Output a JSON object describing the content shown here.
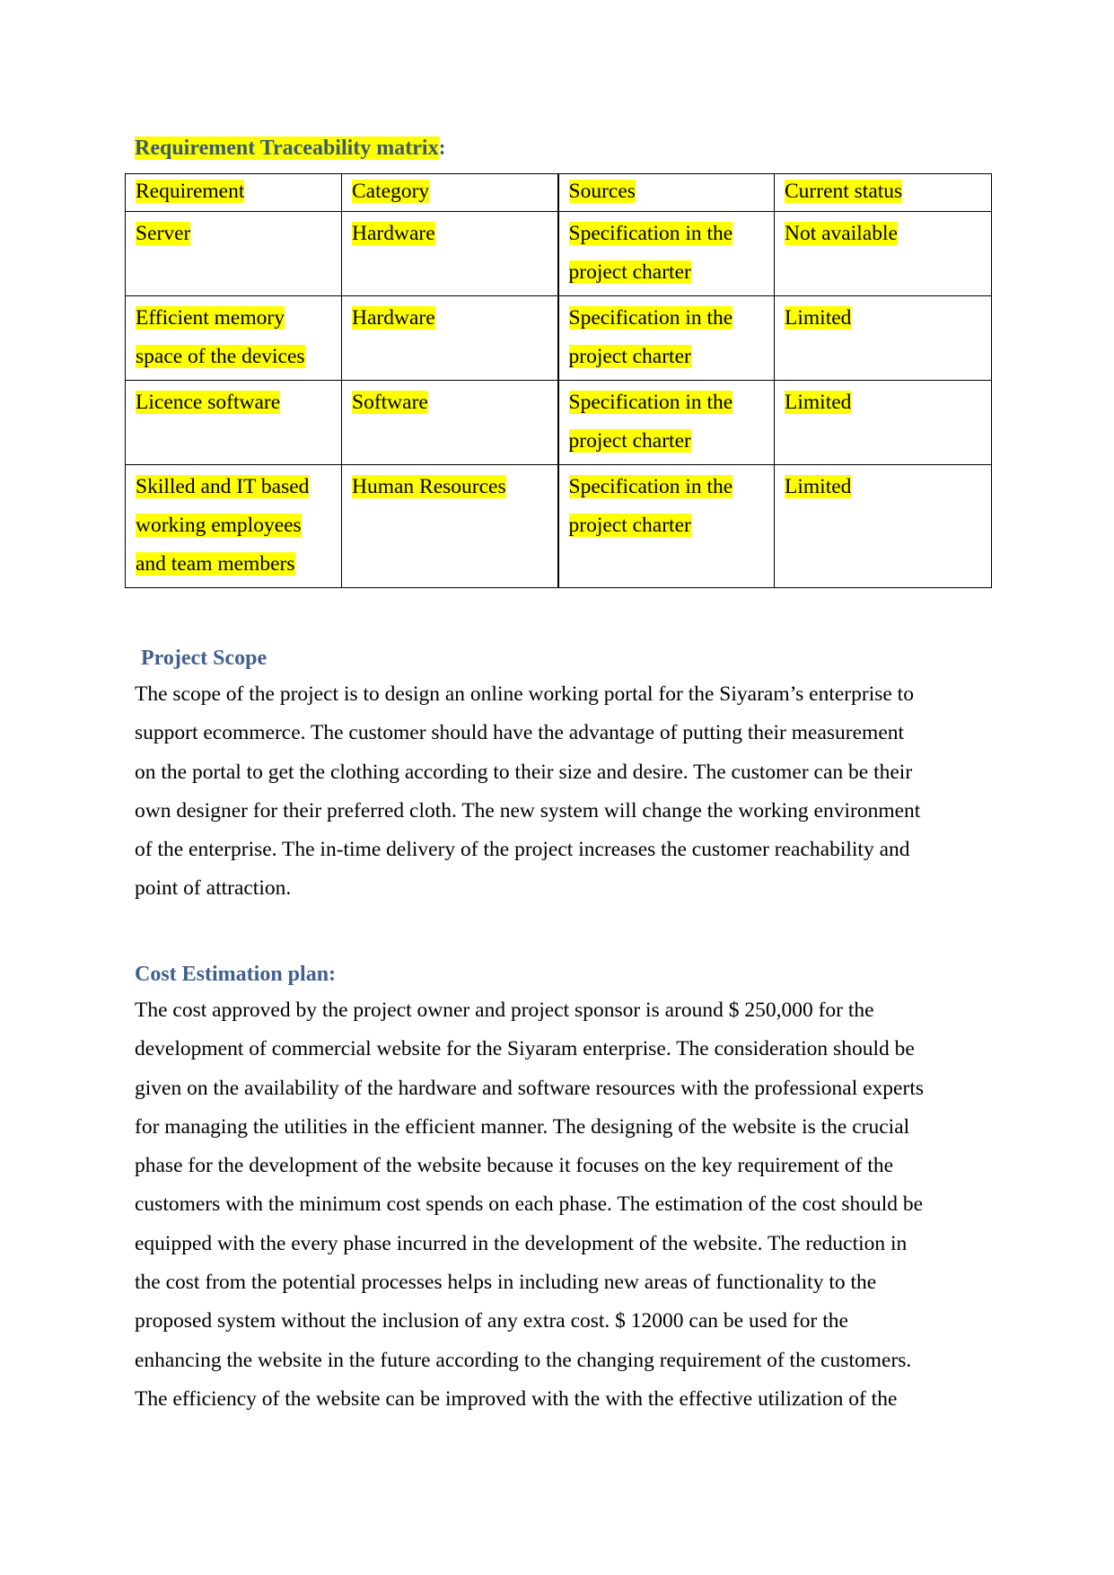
{
  "document": {
    "rtm": {
      "heading": "Requirement Traceability matrix",
      "heading_suffix": ":",
      "columns": [
        "Requirement",
        "Category",
        "Sources",
        "Current status"
      ],
      "rows": [
        {
          "requirement": [
            "Server"
          ],
          "category": [
            "Hardware"
          ],
          "sources": [
            "Specification in the",
            "project charter"
          ],
          "status": [
            "Not available"
          ]
        },
        {
          "requirement": [
            "Efficient memory",
            "space of the devices"
          ],
          "category": [
            "Hardware"
          ],
          "sources": [
            "Specification in the",
            "project charter"
          ],
          "status": [
            "Limited"
          ]
        },
        {
          "requirement": [
            "Licence software"
          ],
          "category": [
            "Software"
          ],
          "sources": [
            "Specification in the",
            "project charter"
          ],
          "status": [
            "Limited"
          ]
        },
        {
          "requirement": [
            "Skilled and IT based",
            "working employees",
            "and team members"
          ],
          "category": [
            "Human Resources"
          ],
          "sources": [
            "Specification in the",
            "project charter"
          ],
          "status": [
            "Limited"
          ]
        }
      ]
    },
    "scope": {
      "heading": "Project Scope",
      "lines": [
        "The scope of the project is to design an online working portal for the Siyaram’s enterprise to",
        "support ecommerce. The customer should have the advantage of putting their measurement",
        "on the portal to get the clothing according to their size and desire. The customer can be their",
        "own designer for their preferred cloth. The new system will change the working environment",
        "of the enterprise. The in-time delivery of the project increases the customer reachability and",
        "point of attraction."
      ]
    },
    "cost": {
      "heading": "Cost Estimation plan:",
      "lines": [
        "The cost approved by the project owner and project sponsor is around $ 250,000 for the",
        "development of commercial website for the Siyaram enterprise. The consideration should be",
        "given on the availability of the hardware and software resources with the professional experts",
        "for managing the utilities in the efficient manner. The designing of the website is the crucial",
        "phase for the development of the website because it focuses on the key requirement of the",
        "customers with the minimum cost spends on each phase. The estimation of the cost should be",
        "equipped with the every phase incurred in the development of the website. The reduction in",
        "the cost from the potential processes helps in including new areas of functionality to the",
        "proposed system without the inclusion of any extra cost. $ 12000 can be used for the",
        "enhancing the website in the future according to the changing requirement of the customers.",
        "The efficiency of the website can be improved with the  with the effective utilization of the"
      ]
    },
    "colors": {
      "highlight": "#ffff00",
      "heading": "#44546a",
      "heading_blue": "#3f5f8f",
      "text": "#000000"
    }
  }
}
